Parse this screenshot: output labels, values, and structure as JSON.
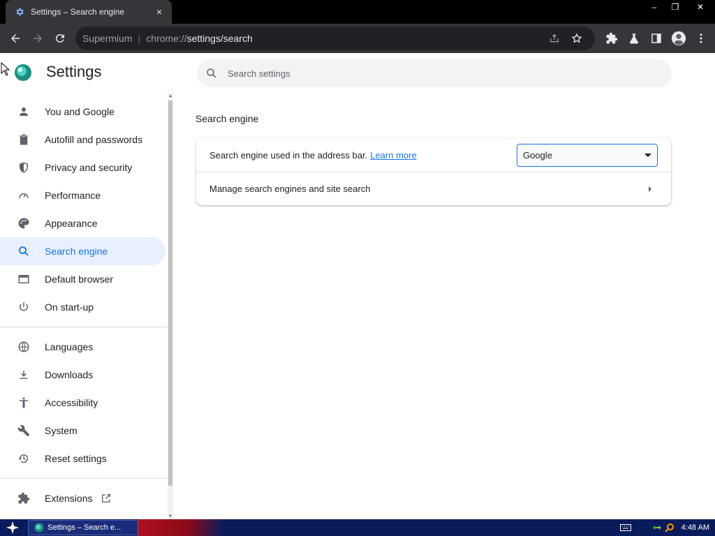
{
  "tab": {
    "title": "Settings – Search engine",
    "close": "×"
  },
  "window_controls": {
    "minimize": "–",
    "restore": "❐",
    "close": "✕"
  },
  "toolbar": {
    "omnibox_host": "Supermium",
    "omnibox_separator": "|",
    "url_scheme": "chrome://",
    "url_path": "settings/search"
  },
  "page": {
    "title": "Settings",
    "search_placeholder": "Search settings",
    "section_title": "Search engine",
    "card": {
      "row1_label": "Search engine used in the address bar.",
      "row1_link": "Learn more",
      "select_value": "Google",
      "row2_label": "Manage search engines and site search"
    }
  },
  "sidebar": {
    "items": [
      {
        "label": "You and Google",
        "icon": "person-icon"
      },
      {
        "label": "Autofill and passwords",
        "icon": "clipboard-icon"
      },
      {
        "label": "Privacy and security",
        "icon": "shield-icon"
      },
      {
        "label": "Performance",
        "icon": "speedometer-icon"
      },
      {
        "label": "Appearance",
        "icon": "palette-icon"
      },
      {
        "label": "Search engine",
        "icon": "search-icon",
        "active": true
      },
      {
        "label": "Default browser",
        "icon": "browser-icon"
      },
      {
        "label": "On start-up",
        "icon": "power-icon"
      },
      {
        "label": "Languages",
        "icon": "globe-icon"
      },
      {
        "label": "Downloads",
        "icon": "download-icon"
      },
      {
        "label": "Accessibility",
        "icon": "accessibility-icon"
      },
      {
        "label": "System",
        "icon": "wrench-icon"
      },
      {
        "label": "Reset settings",
        "icon": "history-icon"
      },
      {
        "label": "Extensions",
        "icon": "puzzle-icon"
      }
    ]
  },
  "taskbar": {
    "window_title": "Settings – Search e...",
    "clock": "4:48 AM"
  },
  "colors": {
    "accent": "#1a73e8",
    "active_bg": "#e8f0fe",
    "toolbar": "#35363a",
    "taskbar": "#0a1b5c"
  }
}
